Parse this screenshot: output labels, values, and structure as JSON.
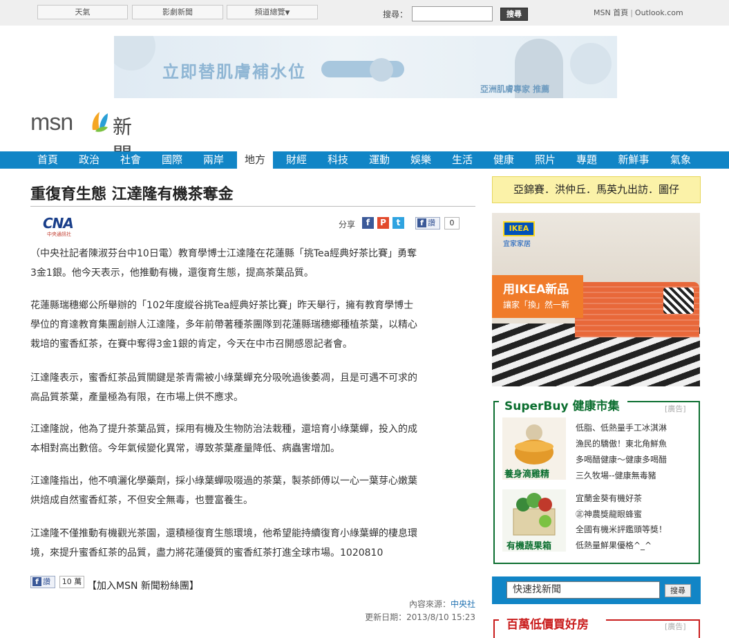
{
  "topbar": {
    "buttons": [
      "天氣",
      "影劇新聞",
      "頻道總覽"
    ],
    "search_label": "搜尋：",
    "search_value": "",
    "search_button": "搜尋",
    "link_home": "MSN 首頁",
    "link_outlook": "Outlook.com"
  },
  "banner": {
    "headline": "立即替肌膚補水位",
    "tagline": "亞洲肌膚專家 推薦"
  },
  "logo": {
    "brand": "msn",
    "section": "新聞"
  },
  "nav": {
    "items": [
      "首頁",
      "政治",
      "社會",
      "國際",
      "兩岸",
      "地方",
      "財經",
      "科技",
      "運動",
      "娛樂",
      "生活",
      "健康",
      "照片",
      "專題",
      "新鮮事",
      "氣象"
    ],
    "active": "地方"
  },
  "article": {
    "title": "重復育生態 江達隆有機茶奪金",
    "source_logo": "CNA",
    "source_logo_sub": "中央通訊社",
    "share_label": "分享",
    "like_label": "讚",
    "like_count": "0",
    "paragraphs": [
      [
        "（中央社記者陳淑芬台中10日電）教育學博士江達隆在花蓮縣「挑Tea經典好茶比賽」勇奪",
        "3金1銀。他今天表示，他推動有機，還復育生態，提高茶葉品質。"
      ],
      [
        "花蓮縣瑞穗鄉公所舉辦的「102年度縱谷挑Tea經典好茶比賽」昨天舉行，擁有教育學博士",
        "學位的育達教育集團創辦人江達隆，多年前帶著種茶團隊到花蓮縣瑞穗鄉種植茶葉，以精心",
        "栽培的蜜香紅茶，在賽中奪得3金1銀的肯定，今天在中市召開感恩記者會。"
      ],
      [
        "江達隆表示，蜜香紅茶品質關鍵是茶青需被小綠葉蟬充分吸吮過後萎凋，且是可遇不可求的",
        "高品質茶葉，產量極為有限，在市場上供不應求。"
      ],
      [
        "江達隆說，他為了提升茶葉品質，採用有機及生物防治法栽種，還培育小綠葉蟬，投入的成",
        "本相對高出數倍。今年氣候變化異常，導致茶葉產量降低、病蟲害增加。"
      ],
      [
        "江達隆指出，他不噴灑化學藥劑，採小綠葉蟬吸啜過的茶葉，製茶師傅以一心一葉芽心嫩葉",
        "烘焙成自然蜜香紅茶，不但安全無毒，也豐富養生。"
      ],
      [
        "江達隆不僅推動有機觀光茶園，還積極復育生態環境，他希望能持續復育小綠葉蟬的棲息環",
        "境，來提升蜜香紅茶的品質，盡力將花蓮優質的蜜香紅茶打進全球市場。1020810"
      ]
    ],
    "bottom_like_label": "讚",
    "bottom_like_count": "10 萬",
    "fans_link": "【加入MSN 新聞粉絲團】",
    "source_label": "內容來源：",
    "source_name": "中央社",
    "updated": "更新日期：2013/8/10 15:23"
  },
  "sidebar": {
    "promo": "亞錦賽．洪仲丘．馬英九出訪．圖仔",
    "ikea": {
      "logo": "IKEA",
      "sub": "宜家家居",
      "headline": "用IKEA新品",
      "tagline": "讓家「換」然一新"
    },
    "superbuy": {
      "title": "SuperBuy 健康市集",
      "ad_tag": "[廣告]",
      "caption1": "養身滴雞精",
      "caption2": "有機蔬果箱",
      "links": [
        "低脂、低熱量手工冰淇淋",
        "漁民的驕傲！東北角鮮魚",
        "多喝醋健康～健康多喝醋",
        "三久牧場--健康無毒豬",
        "宜蘭金葵有機好茶",
        "㊣神農獎龍眼蜂蜜",
        "全國有機米評鑑頭等獎！",
        "低熱量鮮果優格^_^"
      ]
    },
    "quick_search": {
      "value": "快速找新聞",
      "button": "搜尋"
    },
    "house": {
      "title": "百萬低價買好房",
      "ad_tag": "[廣告]"
    }
  },
  "colors": {
    "nav_blue": "#1185c6",
    "superbuy_green": "#0b6e2f",
    "house_red": "#c91b1b"
  }
}
